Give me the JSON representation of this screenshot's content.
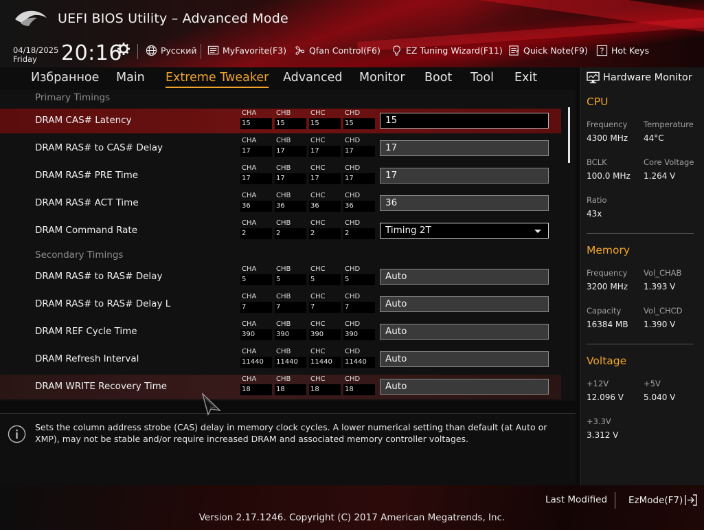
{
  "header": {
    "title": "UEFI BIOS Utility – Advanced Mode",
    "date": "04/18/2025",
    "day": "Friday",
    "time": "20:16",
    "toolbar": {
      "language": "Русский",
      "my_favorite": "MyFavorite(F3)",
      "qfan": "Qfan Control(F6)",
      "ez_tuning": "EZ Tuning Wizard(F11)",
      "quick_note": "Quick Note(F9)",
      "hot_keys": "Hot Keys"
    }
  },
  "tabs": [
    "Избранное",
    "Main",
    "Extreme Tweaker",
    "Advanced",
    "Monitor",
    "Boot",
    "Tool",
    "Exit"
  ],
  "active_tab": "Extreme Tweaker",
  "sections": {
    "primary": "Primary Timings",
    "secondary": "Secondary Timings"
  },
  "channel_names": [
    "CHA",
    "CHB",
    "CHC",
    "CHD"
  ],
  "settings": [
    {
      "label": "DRAM CAS# Latency",
      "channels": [
        "15",
        "15",
        "15",
        "15"
      ],
      "value": "15"
    },
    {
      "label": "DRAM RAS# to CAS# Delay",
      "channels": [
        "17",
        "17",
        "17",
        "17"
      ],
      "value": "17"
    },
    {
      "label": "DRAM RAS# PRE Time",
      "channels": [
        "17",
        "17",
        "17",
        "17"
      ],
      "value": "17"
    },
    {
      "label": "DRAM RAS# ACT Time",
      "channels": [
        "36",
        "36",
        "36",
        "36"
      ],
      "value": "36"
    },
    {
      "label": "DRAM Command Rate",
      "channels": [
        "2",
        "2",
        "2",
        "2"
      ],
      "value": "Timing 2T"
    },
    {
      "label": "DRAM RAS# to RAS# Delay",
      "channels": [
        "5",
        "5",
        "5",
        "5"
      ],
      "value": "Auto"
    },
    {
      "label": "DRAM RAS# to RAS# Delay L",
      "channels": [
        "7",
        "7",
        "7",
        "7"
      ],
      "value": "Auto"
    },
    {
      "label": "DRAM REF Cycle Time",
      "channels": [
        "390",
        "390",
        "390",
        "390"
      ],
      "value": "Auto"
    },
    {
      "label": "DRAM Refresh Interval",
      "channels": [
        "11440",
        "11440",
        "11440",
        "11440"
      ],
      "value": "Auto"
    },
    {
      "label": "DRAM WRITE Recovery Time",
      "channels": [
        "18",
        "18",
        "18",
        "18"
      ],
      "value": "Auto"
    }
  ],
  "help_text": "Sets the column address strobe (CAS) delay in memory clock cycles. A lower numerical setting than default (at Auto or XMP), may not be stable and/or require increased DRAM and associated memory controller voltages.",
  "hardware_monitor": {
    "title": "Hardware Monitor",
    "cpu": {
      "heading": "CPU",
      "frequency_label": "Frequency",
      "frequency": "4300 MHz",
      "temperature_label": "Temperature",
      "temperature": "44°C",
      "bclk_label": "BCLK",
      "bclk": "100.0 MHz",
      "core_voltage_label": "Core Voltage",
      "core_voltage": "1.264 V",
      "ratio_label": "Ratio",
      "ratio": "43x"
    },
    "memory": {
      "heading": "Memory",
      "frequency_label": "Frequency",
      "frequency": "3200 MHz",
      "vol_chab_label": "Vol_CHAB",
      "vol_chab": "1.393 V",
      "capacity_label": "Capacity",
      "capacity": "16384 MB",
      "vol_chcd_label": "Vol_CHCD",
      "vol_chcd": "1.390 V"
    },
    "voltage": {
      "heading": "Voltage",
      "v12_label": "+12V",
      "v12": "12.096 V",
      "v5_label": "+5V",
      "v5": "5.040 V",
      "v33_label": "+3.3V",
      "v33": "3.312 V"
    }
  },
  "footer": {
    "last_modified": "Last Modified",
    "ezmode": "EzMode(F7)",
    "copyright": "Version 2.17.1246. Copyright (C) 2017 American Megatrends, Inc."
  },
  "colors": {
    "accent": "#f0a42a",
    "highlight_row": "#6e1212",
    "brand_red": "#c0101a"
  }
}
